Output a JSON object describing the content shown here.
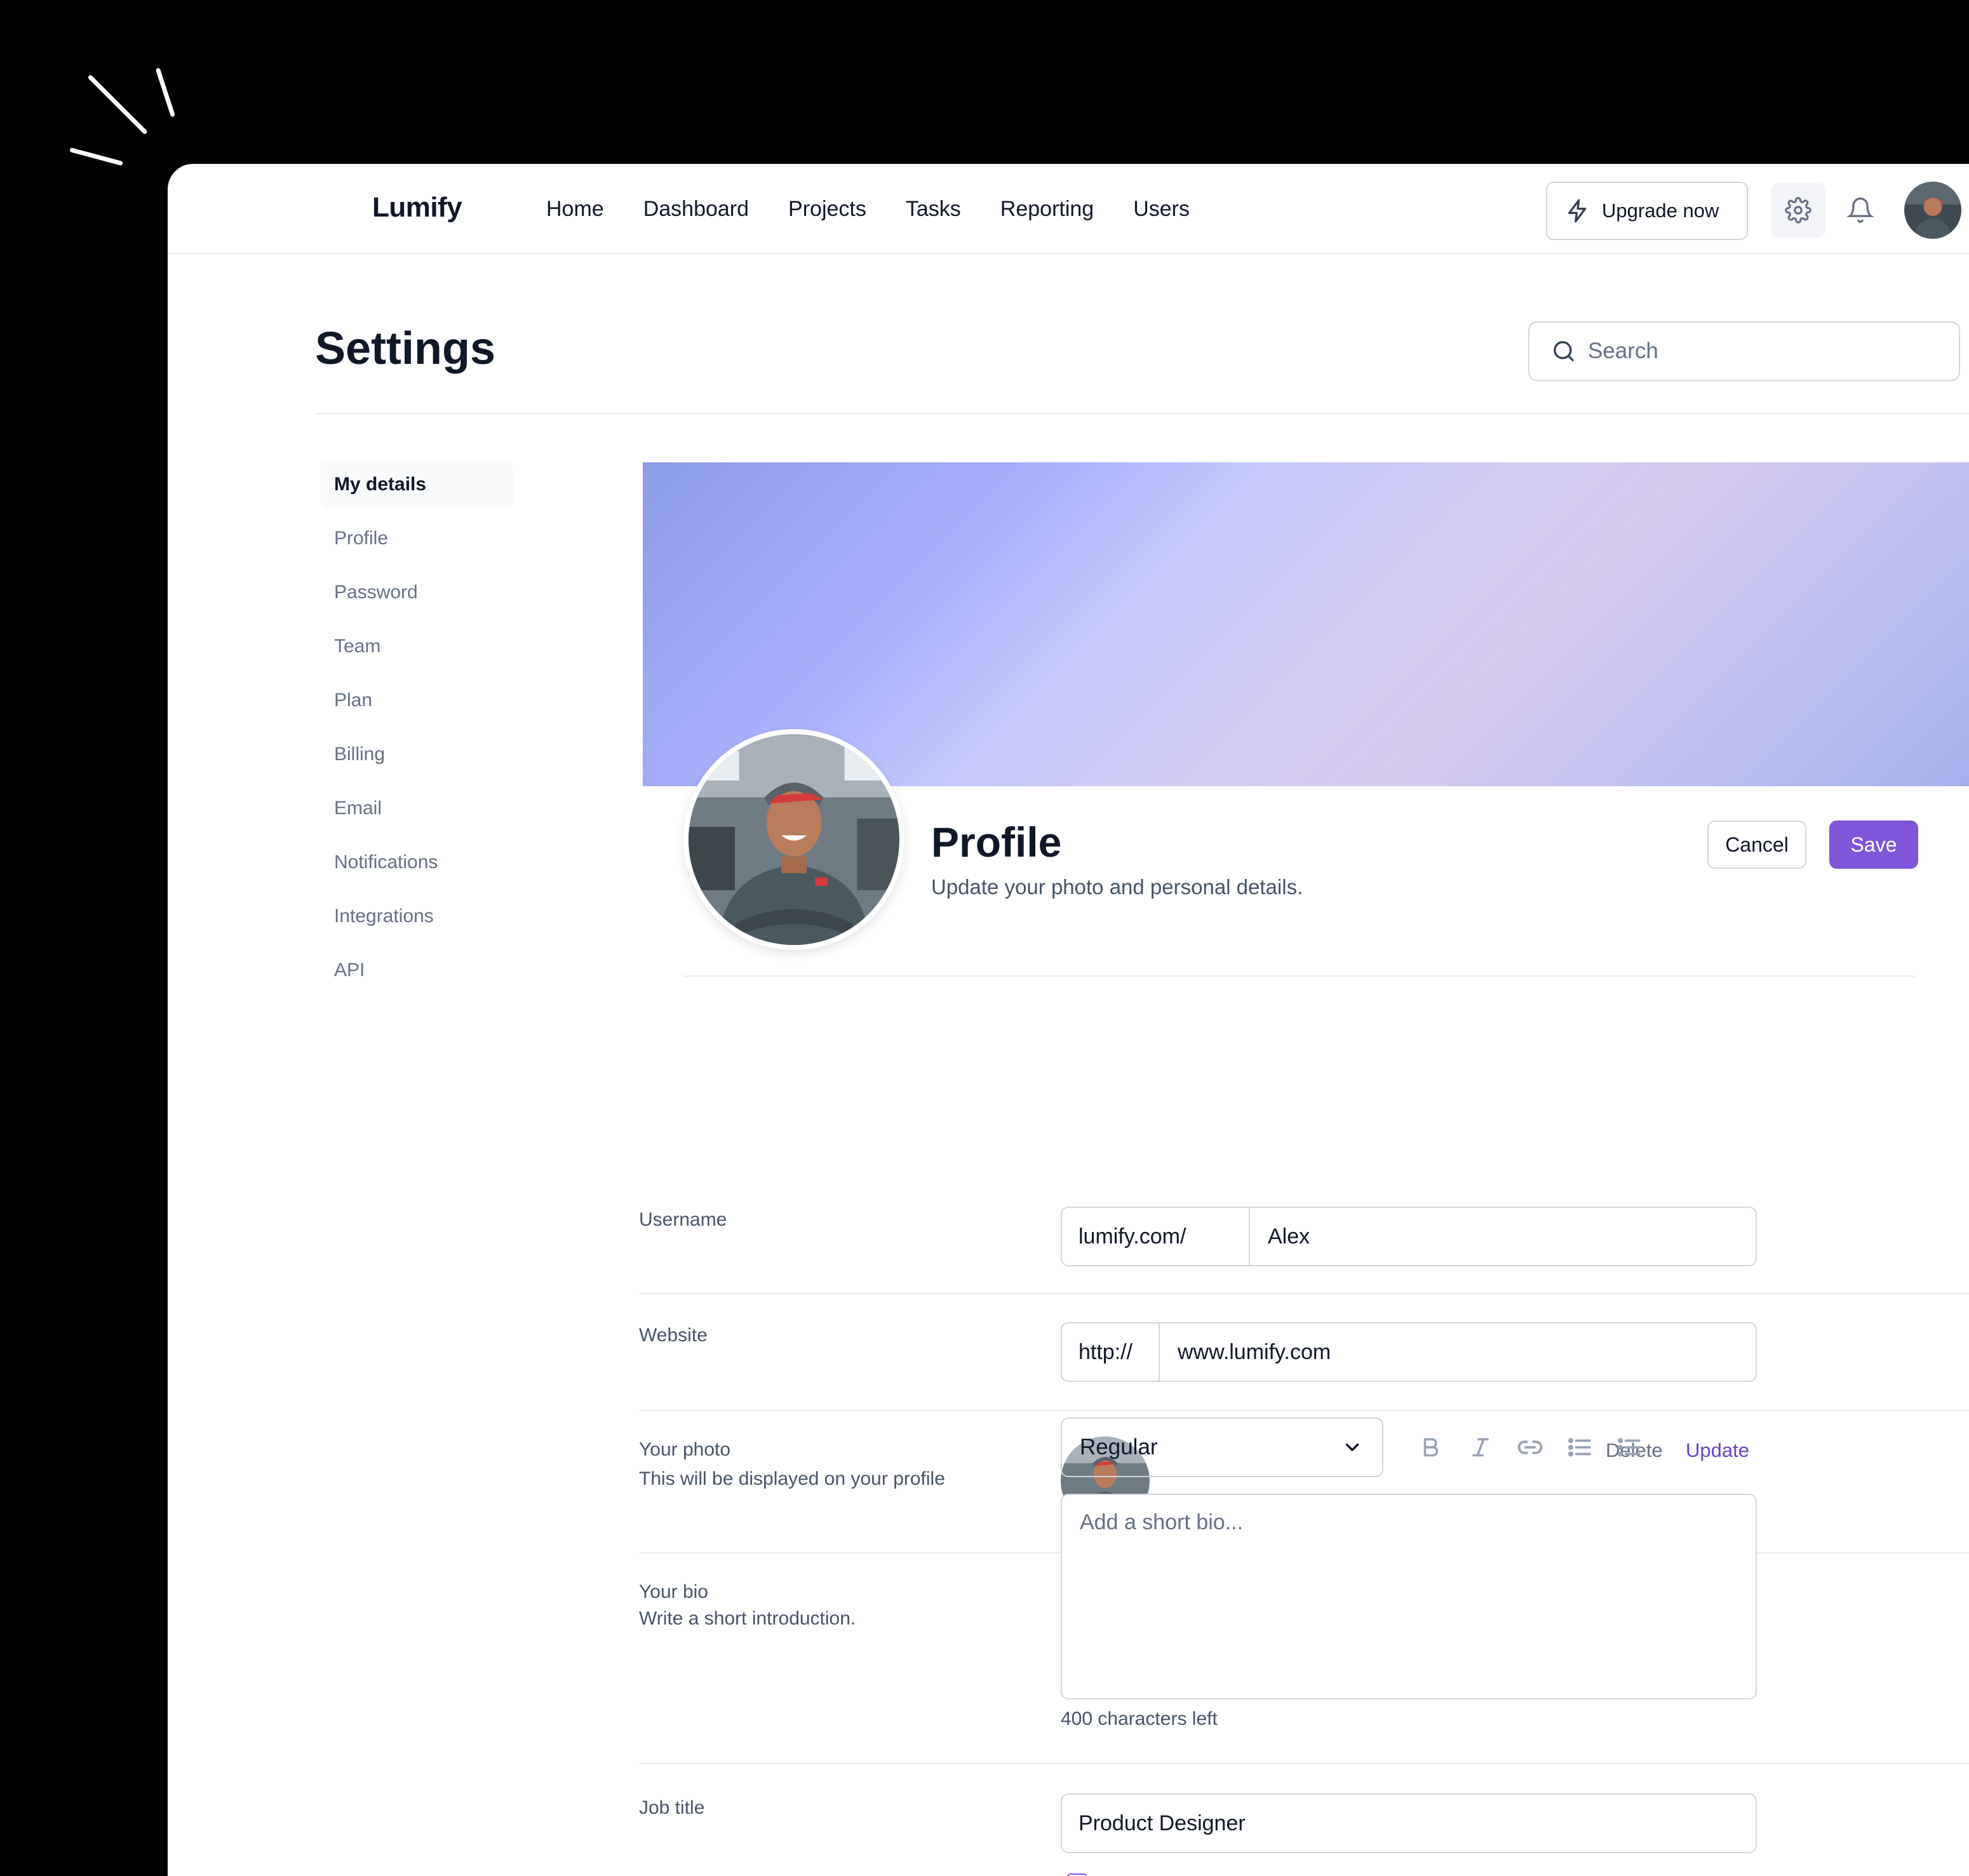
{
  "app": {
    "name": "Lumify"
  },
  "nav": {
    "items": [
      {
        "label": "Home"
      },
      {
        "label": "Dashboard"
      },
      {
        "label": "Projects"
      },
      {
        "label": "Tasks"
      },
      {
        "label": "Reporting"
      },
      {
        "label": "Users"
      }
    ],
    "upgrade_label": "Upgrade now"
  },
  "header": {
    "title": "Settings",
    "search_placeholder": "Search"
  },
  "sidebar": {
    "items": [
      {
        "label": "My details",
        "active": true
      },
      {
        "label": "Profile"
      },
      {
        "label": "Password"
      },
      {
        "label": "Team"
      },
      {
        "label": "Plan"
      },
      {
        "label": "Billing"
      },
      {
        "label": "Email"
      },
      {
        "label": "Notifications"
      },
      {
        "label": "Integrations"
      },
      {
        "label": "API"
      }
    ]
  },
  "profile": {
    "heading": "Profile",
    "subtitle": "Update your photo and personal details.",
    "cancel_label": "Cancel",
    "save_label": "Save"
  },
  "form": {
    "username": {
      "label": "Username",
      "prefix": "lumify.com/",
      "value": "Alex"
    },
    "website": {
      "label": "Website",
      "prefix": "http://",
      "value": "www.lumify.com"
    },
    "photo": {
      "label": "Your photo",
      "hint": "This will be displayed on your profile",
      "delete_label": "Delete",
      "update_label": "Update"
    },
    "bio": {
      "label": "Your bio",
      "hint": "Write a short introduction.",
      "style_value": "Regular",
      "placeholder": "Add a short bio...",
      "chars_left": "400 characters left",
      "tools": [
        "bold-icon",
        "italic-icon",
        "link-icon",
        "bullet-list-icon",
        "numbered-list-icon"
      ]
    },
    "job_title": {
      "label": "Job title",
      "value": "Product Designer"
    }
  },
  "colors": {
    "accent": "#7f56d9",
    "link": "#6941c6",
    "border": "#d0d5dd",
    "divider": "#eaecf0"
  }
}
